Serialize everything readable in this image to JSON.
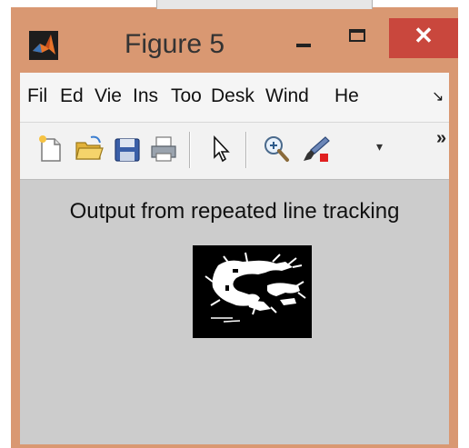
{
  "window": {
    "title": "Figure 5",
    "close_symbol": "✕",
    "icons": {
      "app": "matlab-icon",
      "minimize": "minimize-icon",
      "maximize": "maximize-icon",
      "close": "close-icon"
    },
    "colors": {
      "frame": "#d99872",
      "close": "#c9473d",
      "client": "#cccccc"
    }
  },
  "menubar": {
    "items": [
      "Fil",
      "Ed",
      "Vie",
      "Ins",
      "Too",
      "Desk",
      "Wind",
      "He"
    ],
    "overflow_icon": "chevron-overflow-icon",
    "overflow_symbol": "↘"
  },
  "toolbar": {
    "icons": [
      "new-file-icon",
      "open-folder-icon",
      "save-icon",
      "print-icon",
      "pointer-icon",
      "zoom-in-icon",
      "brush-icon"
    ],
    "brush_dropdown_symbol": "▾",
    "more_symbol": "»"
  },
  "plot": {
    "title": "Output from repeated line tracking",
    "image": "binary-vein-image"
  }
}
